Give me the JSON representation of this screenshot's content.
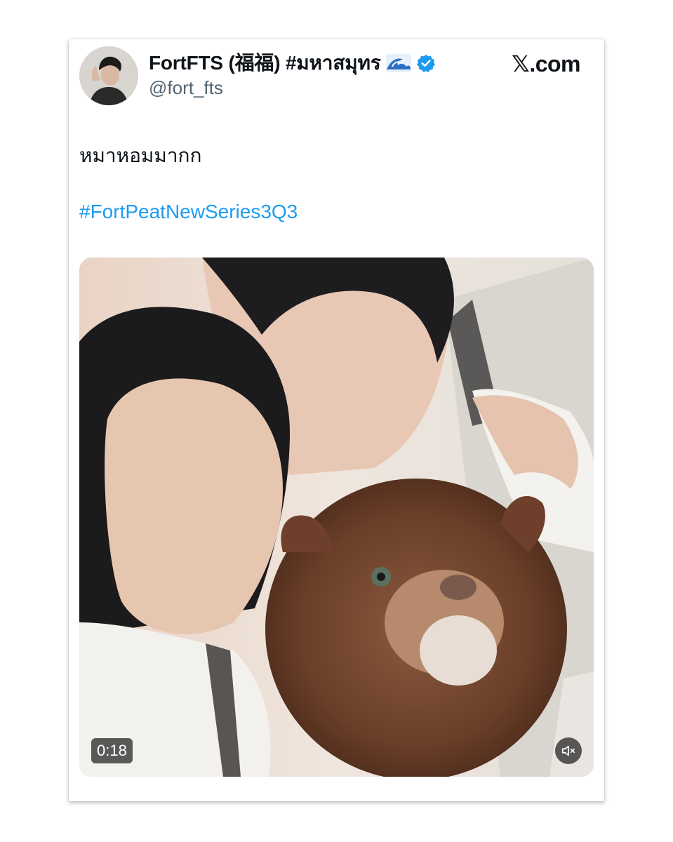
{
  "tweet": {
    "display_name": "FortFTS (福福) #มหาสมุทร",
    "wave_emoji": "🌊",
    "handle": "@fort_fts",
    "brand": "𝕏.com",
    "text": "หมาหอมมากก",
    "hashtag": "#FortPeatNewSeries3Q3"
  },
  "video": {
    "duration": "0:18",
    "muted": true
  },
  "icons": {
    "verified": "verified-badge-icon",
    "mute": "speaker-muted-icon",
    "wave": "wave-emoji-icon"
  },
  "colors": {
    "link": "#1d9bf0",
    "verified": "#1d9bf0",
    "text": "#0f1419",
    "secondary": "#536471"
  }
}
